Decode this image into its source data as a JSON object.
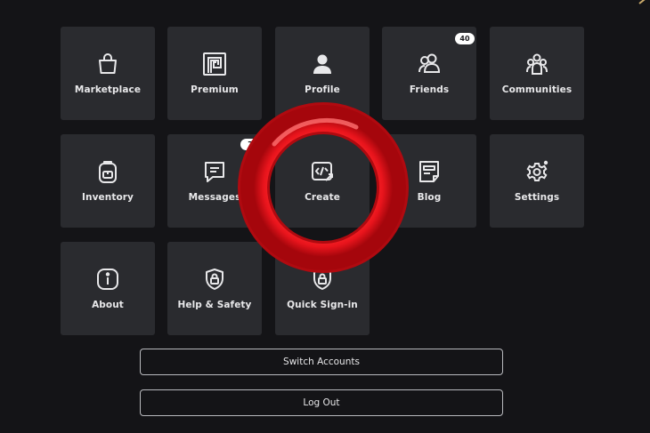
{
  "tiles": [
    {
      "id": "marketplace",
      "label": "Marketplace",
      "icon": "shopping-bag-icon"
    },
    {
      "id": "premium",
      "label": "Premium",
      "icon": "premium-icon"
    },
    {
      "id": "profile",
      "label": "Profile",
      "icon": "user-icon"
    },
    {
      "id": "friends",
      "label": "Friends",
      "icon": "friends-icon",
      "badge": "40"
    },
    {
      "id": "communities",
      "label": "Communities",
      "icon": "communities-icon"
    },
    {
      "id": "inventory",
      "label": "Inventory",
      "icon": "backpack-icon"
    },
    {
      "id": "messages",
      "label": "Messages",
      "icon": "message-icon",
      "badge": "7"
    },
    {
      "id": "create",
      "label": "Create",
      "icon": "code-icon"
    },
    {
      "id": "blog",
      "label": "Blog",
      "icon": "blog-icon"
    },
    {
      "id": "settings",
      "label": "Settings",
      "icon": "gear-icon"
    },
    {
      "id": "about",
      "label": "About",
      "icon": "info-icon"
    },
    {
      "id": "help",
      "label": "Help & Safety",
      "icon": "shield-lock-icon"
    },
    {
      "id": "quick",
      "label": "Quick Sign-in",
      "icon": "shield-lock-icon"
    }
  ],
  "buttons": {
    "switch_accounts": "Switch Accounts",
    "log_out": "Log Out"
  },
  "colors": {
    "background": "#141417",
    "tile": "#2a2b2f",
    "highlight_ring": "#e8141c"
  }
}
